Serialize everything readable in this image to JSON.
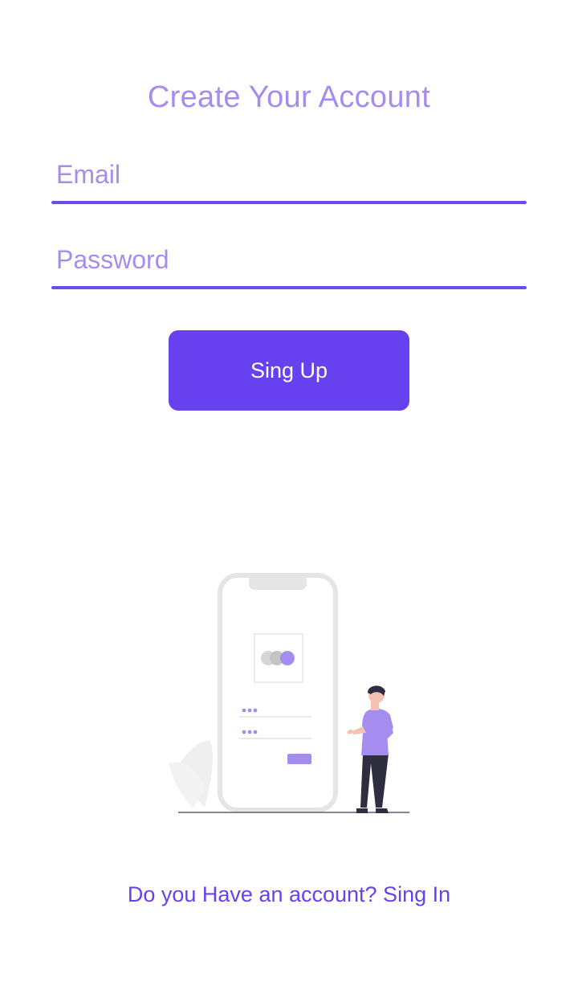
{
  "page": {
    "title": "Create Your Account"
  },
  "form": {
    "email_placeholder": "Email",
    "email_value": "",
    "password_placeholder": "Password",
    "password_value": "",
    "submit_label": "Sing Up"
  },
  "footer": {
    "signin_text": "Do you Have an account? Sing In"
  },
  "colors": {
    "accent": "#6741f0",
    "accent_light": "#a58df0",
    "background": "#ffffff"
  },
  "illustration": {
    "icon": "phone-login-illustration"
  }
}
